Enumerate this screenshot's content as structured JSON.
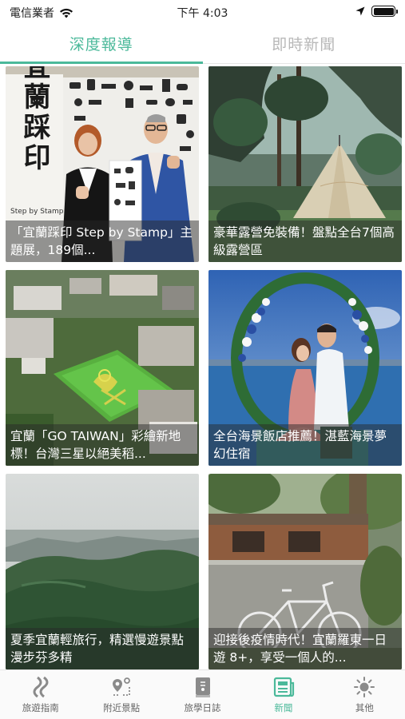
{
  "status": {
    "carrier": "電信業者",
    "time": "下午 4:03"
  },
  "tabs": [
    {
      "label": "深度報導",
      "active": true
    },
    {
      "label": "即時新聞",
      "active": false
    }
  ],
  "articles": [
    {
      "title": "「宜蘭踩印 Step by Stamp」主題展，189個..."
    },
    {
      "title": "豪華露營免裝備！盤點全台7個高級露營區"
    },
    {
      "title": "宜蘭「GO TAIWAN」彩繪新地標！台灣三星以絕美稻..."
    },
    {
      "title": "全台海景飯店推薦！湛藍海景夢幻住宿"
    },
    {
      "title": "夏季宜蘭輕旅行，精選慢遊景點漫步芬多精"
    },
    {
      "title": "迎接後疫情時代！宜蘭羅東一日遊 8+，享受一個人的..."
    }
  ],
  "photo_text": {
    "exhibit_sign": "宜蘭踩印",
    "exhibit_sub": "Step by Stamp"
  },
  "bottom_nav": [
    {
      "label": "旅遊指南",
      "icon": "road-icon"
    },
    {
      "label": "附近景點",
      "icon": "map-pin-icon"
    },
    {
      "label": "旅學日誌",
      "icon": "journal-icon"
    },
    {
      "label": "新聞",
      "icon": "news-icon",
      "active": true
    },
    {
      "label": "其他",
      "icon": "sun-icon"
    }
  ],
  "colors": {
    "accent": "#4bb99a",
    "inactive_tab": "#b8b8b8"
  }
}
